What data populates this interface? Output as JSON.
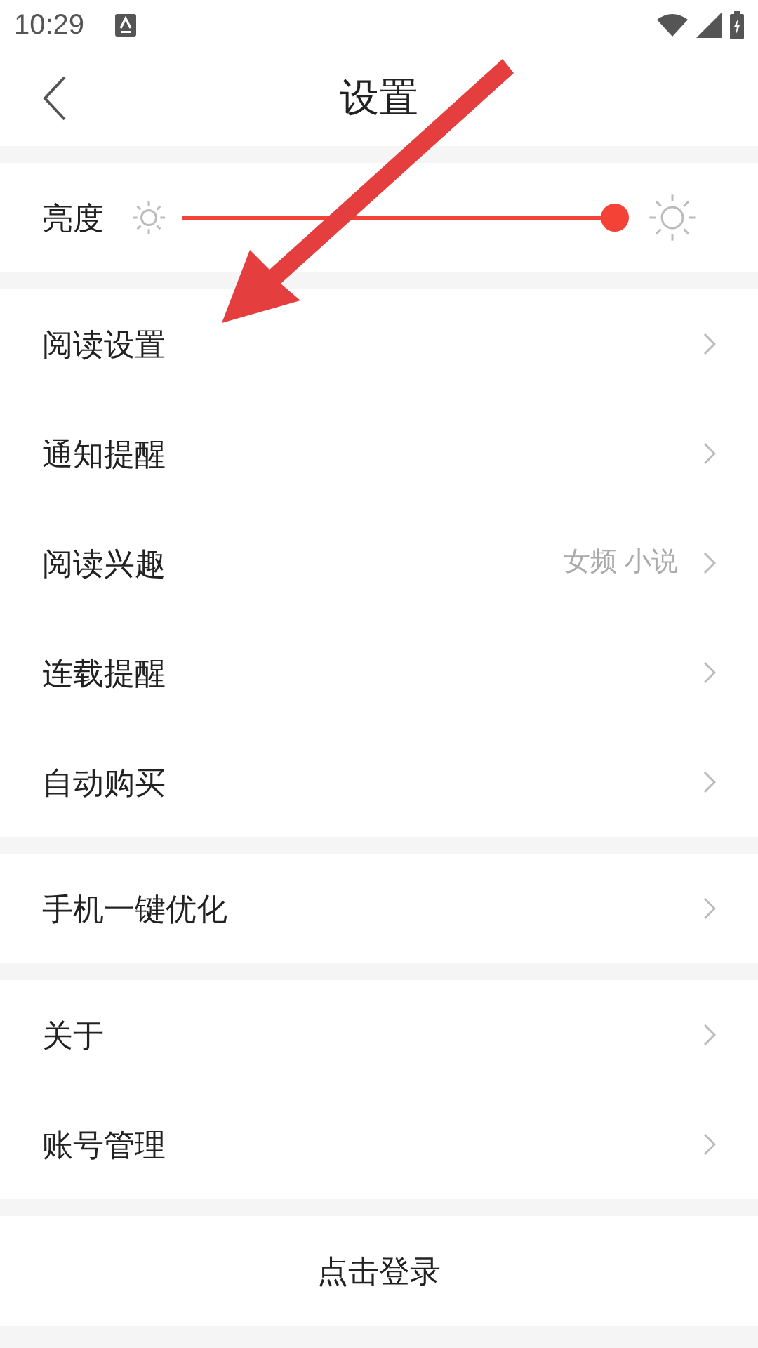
{
  "status_bar": {
    "time": "10:29"
  },
  "header": {
    "title": "设置"
  },
  "brightness": {
    "label": "亮度",
    "level": 1
  },
  "sections": [
    {
      "items": [
        {
          "label": "阅读设置"
        },
        {
          "label": "通知提醒"
        },
        {
          "label": "阅读兴趣",
          "value": "女频 小说"
        },
        {
          "label": "连载提醒"
        },
        {
          "label": "自动购买"
        }
      ]
    },
    {
      "items": [
        {
          "label": "手机一键优化"
        }
      ]
    },
    {
      "items": [
        {
          "label": "关于"
        },
        {
          "label": "账号管理"
        }
      ]
    }
  ],
  "login_button": "点击登录"
}
